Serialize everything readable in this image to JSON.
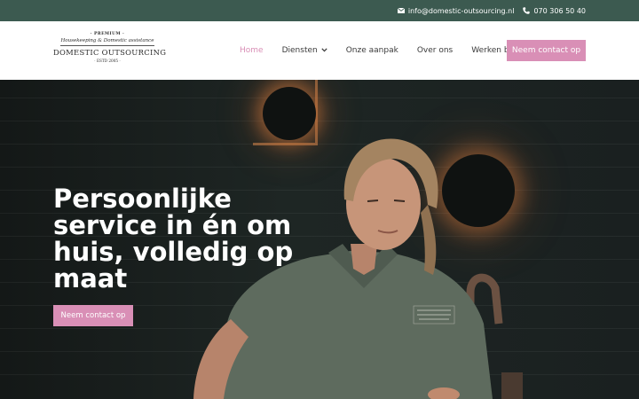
{
  "topbar": {
    "email": "info@domestic-outsourcing.nl",
    "phone": "070 306 50 40",
    "email_icon": "envelope-icon",
    "phone_icon": "phone-icon"
  },
  "logo": {
    "premium": "· PREMIUM ·",
    "tagline": "Housekeeping & Domestic assistance",
    "brand": "DOMESTIC OUTSOURCING",
    "estd": "· ESTD 2005 ·"
  },
  "nav": {
    "items": [
      {
        "label": "Home",
        "active": true
      },
      {
        "label": "Diensten",
        "has_dropdown": true
      },
      {
        "label": "Onze aanpak"
      },
      {
        "label": "Over ons"
      },
      {
        "label": "Werken bij"
      }
    ],
    "cta_label": "Neem contact op"
  },
  "hero": {
    "title": "Persoonlijke service in én om huis, volledig op maat",
    "cta_label": "Neem contact op"
  },
  "colors": {
    "topbar_bg": "#3c5a50",
    "accent_pink": "#d98fb6",
    "active_nav": "#d98fb6",
    "hero_text": "#ffffff"
  }
}
